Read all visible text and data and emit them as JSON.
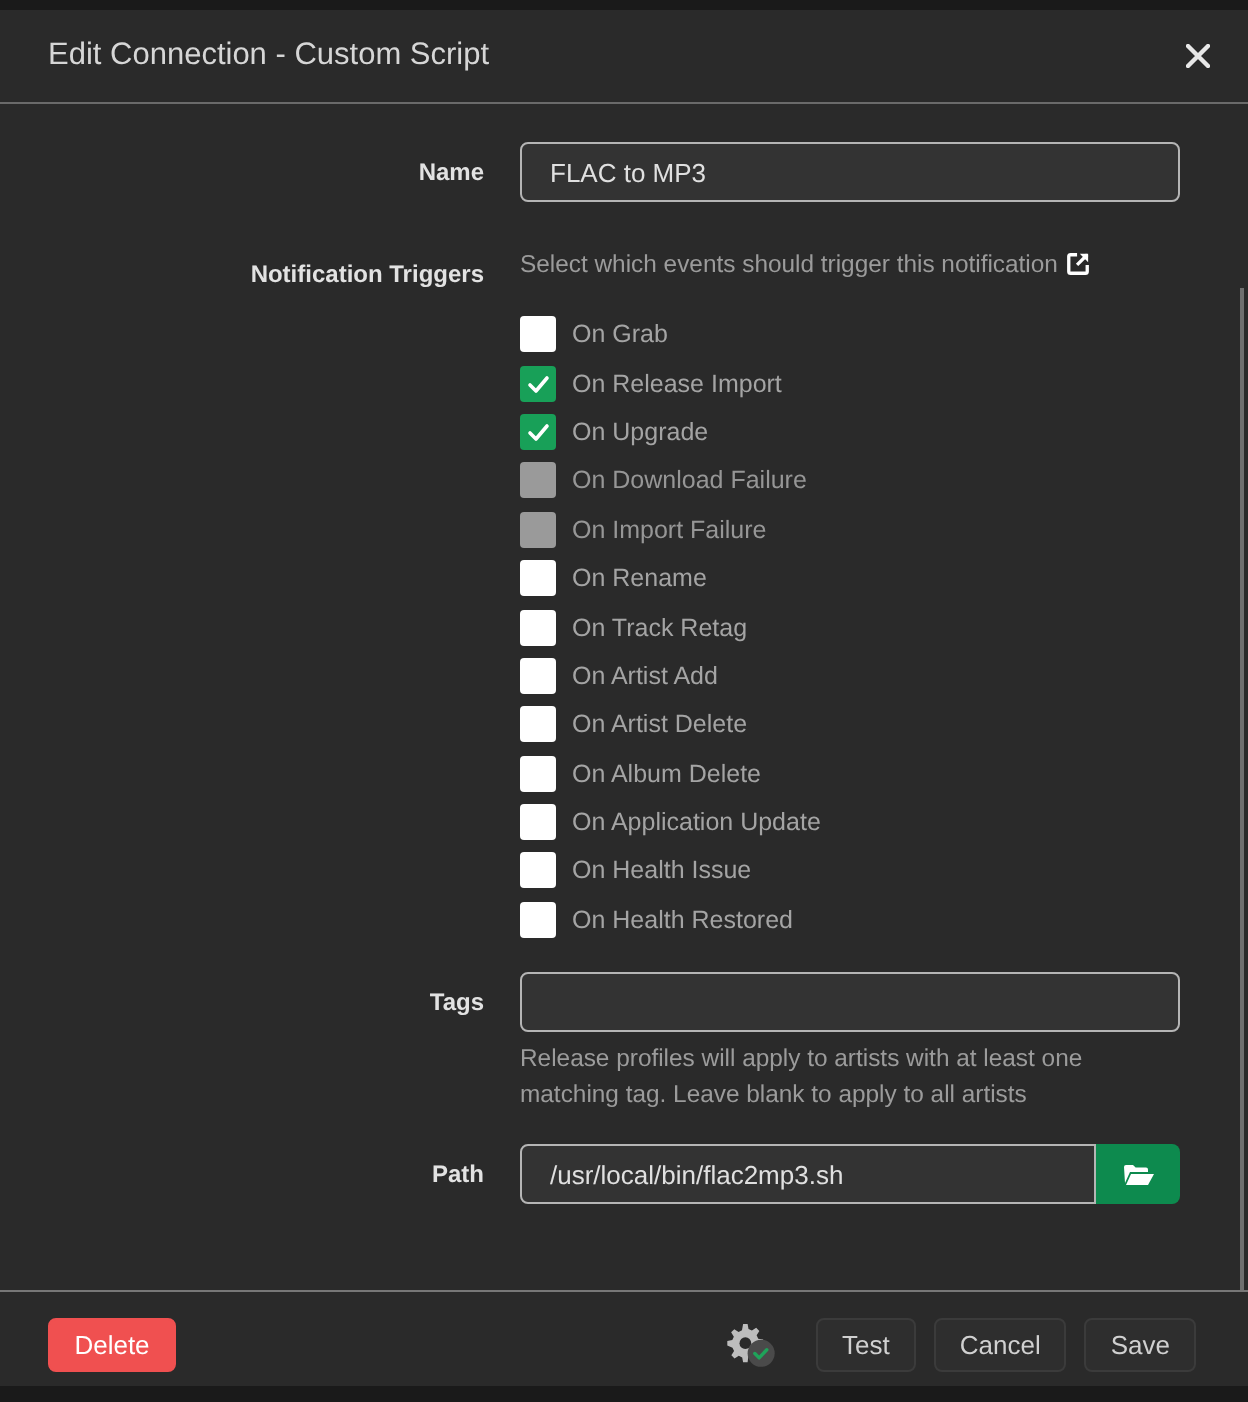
{
  "dialog": {
    "title": "Edit Connection - Custom Script"
  },
  "fields": [
    {
      "kind": "text",
      "label": "Name",
      "value": "FLAC to MP3"
    },
    {
      "kind": "checklist",
      "label": "Notification Triggers",
      "help": "Select which events should trigger this notification",
      "options": [
        {
          "label": "On Grab",
          "checked": false,
          "disabled": false
        },
        {
          "label": "On Release Import",
          "checked": true,
          "disabled": false
        },
        {
          "label": "On Upgrade",
          "checked": true,
          "disabled": false
        },
        {
          "label": "On Download Failure",
          "checked": false,
          "disabled": true
        },
        {
          "label": "On Import Failure",
          "checked": false,
          "disabled": true
        },
        {
          "label": "On Rename",
          "checked": false,
          "disabled": false
        },
        {
          "label": "On Track Retag",
          "checked": false,
          "disabled": false
        },
        {
          "label": "On Artist Add",
          "checked": false,
          "disabled": false
        },
        {
          "label": "On Artist Delete",
          "checked": false,
          "disabled": false
        },
        {
          "label": "On Album Delete",
          "checked": false,
          "disabled": false
        },
        {
          "label": "On Application Update",
          "checked": false,
          "disabled": false
        },
        {
          "label": "On Health Issue",
          "checked": false,
          "disabled": false
        },
        {
          "label": "On Health Restored",
          "checked": false,
          "disabled": false
        }
      ]
    },
    {
      "kind": "tags",
      "label": "Tags",
      "help": "Release profiles will apply to artists with at least one matching tag. Leave blank to apply to all artists"
    },
    {
      "kind": "path",
      "label": "Path",
      "value": "/usr/local/bin/flac2mp3.sh"
    }
  ],
  "buttons": [
    {
      "label": "Delete",
      "kind": "danger"
    },
    {
      "label": "Test",
      "kind": "default"
    },
    {
      "label": "Cancel",
      "kind": "default"
    },
    {
      "label": "Save",
      "kind": "default"
    }
  ]
}
